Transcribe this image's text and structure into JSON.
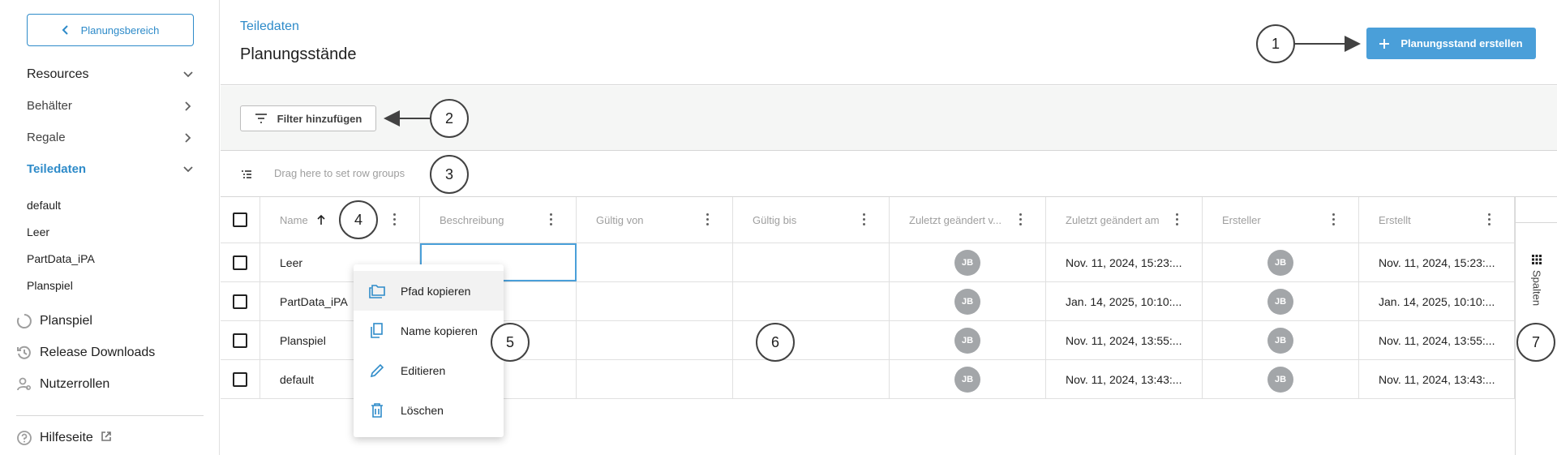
{
  "sidebar": {
    "back_label": "Planungsbereich",
    "sections": [
      {
        "label": "Resources",
        "chevron": "down"
      },
      {
        "label": "Behälter",
        "chevron": "right"
      },
      {
        "label": "Regale",
        "chevron": "right"
      },
      {
        "label": "Teiledaten",
        "chevron": "down",
        "active": true
      }
    ],
    "sub_items": [
      "default",
      "Leer",
      "PartData_iPA",
      "Planspiel"
    ],
    "icon_items": [
      {
        "label": "Planspiel",
        "icon": "progress-circle-icon"
      },
      {
        "label": "Release Downloads",
        "icon": "history-icon"
      },
      {
        "label": "Nutzerrollen",
        "icon": "user-settings-icon"
      }
    ],
    "help_label": "Hilfeseite"
  },
  "header": {
    "breadcrumb": "Teiledaten",
    "title": "Planungsstände",
    "create_button": "Planungsstand erstellen"
  },
  "filter": {
    "button_label": "Filter hinzufügen"
  },
  "row_group": {
    "placeholder": "Drag here to set row groups"
  },
  "grid": {
    "columns": [
      "Name",
      "Beschreibung",
      "Gültig von",
      "Gültig bis",
      "Zuletzt geändert v...",
      "Zuletzt geändert am",
      "Ersteller",
      "Erstellt"
    ],
    "rows": [
      {
        "name": "Leer",
        "beschreibung": "",
        "gueltig_von": "",
        "gueltig_bis": "",
        "geaendert_von": "JB",
        "geaendert_am": "Nov. 11, 2024, 15:23:...",
        "ersteller": "JB",
        "erstellt": "Nov. 11, 2024, 15:23:..."
      },
      {
        "name": "PartData_iPA",
        "beschreibung": "",
        "gueltig_von": "",
        "gueltig_bis": "",
        "geaendert_von": "JB",
        "geaendert_am": "Jan. 14, 2025, 10:10:...",
        "ersteller": "JB",
        "erstellt": "Jan. 14, 2025, 10:10:..."
      },
      {
        "name": "Planspiel",
        "beschreibung": "",
        "gueltig_von": "",
        "gueltig_bis": "",
        "geaendert_von": "JB",
        "geaendert_am": "Nov. 11, 2024, 13:55:...",
        "ersteller": "JB",
        "erstellt": "Nov. 11, 2024, 13:55:..."
      },
      {
        "name": "default",
        "beschreibung": "",
        "gueltig_von": "",
        "gueltig_bis": "",
        "geaendert_von": "JB",
        "geaendert_am": "Nov. 11, 2024, 13:43:...",
        "ersteller": "JB",
        "erstellt": "Nov. 11, 2024, 13:43:..."
      }
    ]
  },
  "side_panel": {
    "columns_label": "Spalten"
  },
  "context_menu": {
    "items": [
      "Pfad kopieren",
      "Name kopieren",
      "Editieren",
      "Löschen"
    ]
  },
  "annotations": [
    "1",
    "2",
    "3",
    "4",
    "5",
    "6",
    "7"
  ],
  "colors": {
    "accent": "#2e8bc9",
    "primary_button": "#4a9fd9",
    "avatar": "#a3a6a9"
  }
}
